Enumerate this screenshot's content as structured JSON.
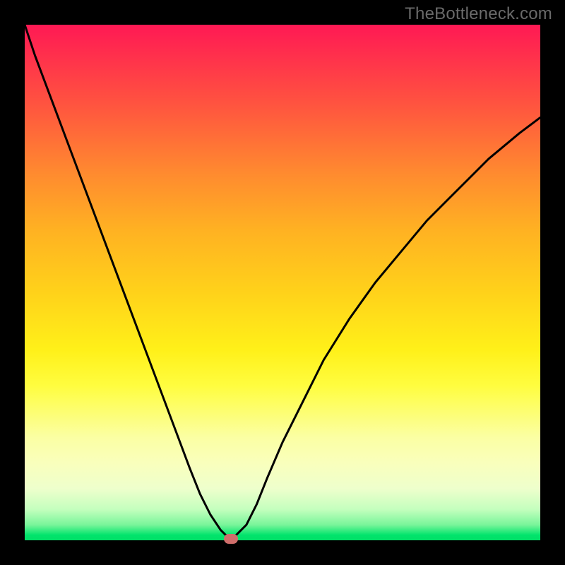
{
  "watermark": "TheBottleneck.com",
  "chart_data": {
    "type": "line",
    "title": "",
    "xlabel": "",
    "ylabel": "",
    "xlim": [
      0,
      100
    ],
    "ylim": [
      0,
      100
    ],
    "series": [
      {
        "name": "bottleneck-curve",
        "x": [
          0,
          2,
          5,
          8,
          11,
          14,
          17,
          20,
          23,
          26,
          29,
          32,
          34,
          36,
          38,
          39,
          40,
          41,
          43,
          45,
          47,
          50,
          54,
          58,
          63,
          68,
          73,
          78,
          84,
          90,
          96,
          100
        ],
        "y": [
          100,
          94,
          86,
          78,
          70,
          62,
          54,
          46,
          38,
          30,
          22,
          14,
          9,
          5,
          2,
          1,
          0.5,
          1,
          3,
          7,
          12,
          19,
          27,
          35,
          43,
          50,
          56,
          62,
          68,
          74,
          79,
          82
        ],
        "color": "#000000"
      }
    ],
    "marker": {
      "x": 40,
      "y": 0.3,
      "color": "#cf6e6b"
    },
    "background_gradient": {
      "top": "#ff1954",
      "middle": "#fff019",
      "bottom": "#01df67"
    }
  }
}
